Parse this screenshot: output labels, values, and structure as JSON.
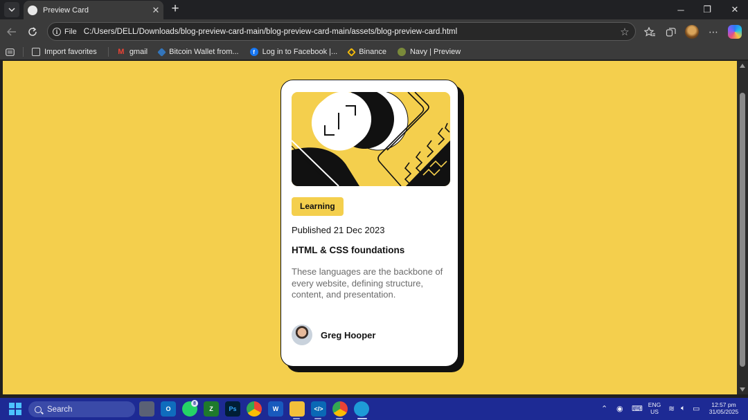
{
  "browser": {
    "tab": {
      "title": "Preview Card",
      "close": "✕"
    },
    "new_tab": "+",
    "window_controls": {
      "minimize": "─",
      "restore": "❐",
      "close": "✕"
    },
    "address": {
      "scheme": "File",
      "url": "C:/Users/DELL/Downloads/blog-preview-card-main/blog-preview-card-main/assets/blog-preview-card.html"
    },
    "favorites": [
      {
        "label": "Import favorites",
        "icon": "import-icon"
      },
      {
        "label": "gmail",
        "icon": "gmail-icon"
      },
      {
        "label": "Bitcoin Wallet from...",
        "icon": "bitcoin-wallet-icon"
      },
      {
        "label": "Log in to Facebook |...",
        "icon": "facebook-icon"
      },
      {
        "label": "Binance",
        "icon": "binance-icon"
      },
      {
        "label": "Navy | Preview",
        "icon": "navy-icon"
      }
    ]
  },
  "card": {
    "tag": "Learning",
    "published": "Published 21 Dec 2023",
    "title": "HTML & CSS foundations",
    "description": "These languages are the backbone of every website, defining structure, content, and presentation.",
    "author": "Greg Hooper"
  },
  "colors": {
    "page_background": "#f4cf4d",
    "card_background": "#ffffff",
    "shadow": "#111111",
    "taskbar": "#1d2a94"
  },
  "taskbar": {
    "search_placeholder": "Search",
    "whatsapp_badge": "8",
    "language": "ENG",
    "region": "US",
    "time": "12:57 pm",
    "date": "31/05/2025"
  }
}
